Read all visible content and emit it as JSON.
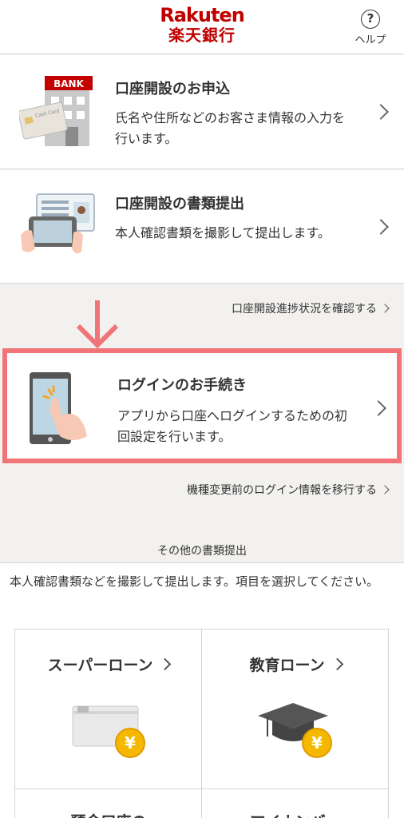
{
  "header": {
    "brand_en": "Rakuten",
    "brand_jp": "楽天銀行",
    "help_icon": "?",
    "help_label": "ヘルプ"
  },
  "cards": [
    {
      "title": "口座開設のお申込",
      "desc": "氏名や住所などのお客さま情報の入力を行います。",
      "image": "bank-card-icon",
      "bank_sign": "BANK",
      "card_text": "Cash Card"
    },
    {
      "title": "口座開設の書類提出",
      "desc": "本人確認書類を撮影して提出します。",
      "image": "id-photo-icon"
    }
  ],
  "progress_link": "口座開設進捗状況を確認する",
  "login": {
    "title": "ログインのお手続き",
    "desc": "アプリから口座へログインするための初回設定を行います。",
    "image": "phone-tap-icon"
  },
  "migrate_link": "機種変更前のログイン情報を移行する",
  "other_section": {
    "label": "その他の書類提出",
    "intro": "本人確認書類などを撮影して提出します。項目を選択してください。",
    "tiles": [
      {
        "label": "スーパーローン",
        "icon": "card-yen-icon"
      },
      {
        "label": "教育ローン",
        "icon": "graduation-cap-yen-icon"
      },
      {
        "label": "預金口座の"
      },
      {
        "label": "マイナンバー"
      }
    ],
    "yen_symbol": "¥"
  },
  "colors": {
    "brand": "#bf0000",
    "highlight": "#f07478",
    "coin": "#f5b800"
  }
}
